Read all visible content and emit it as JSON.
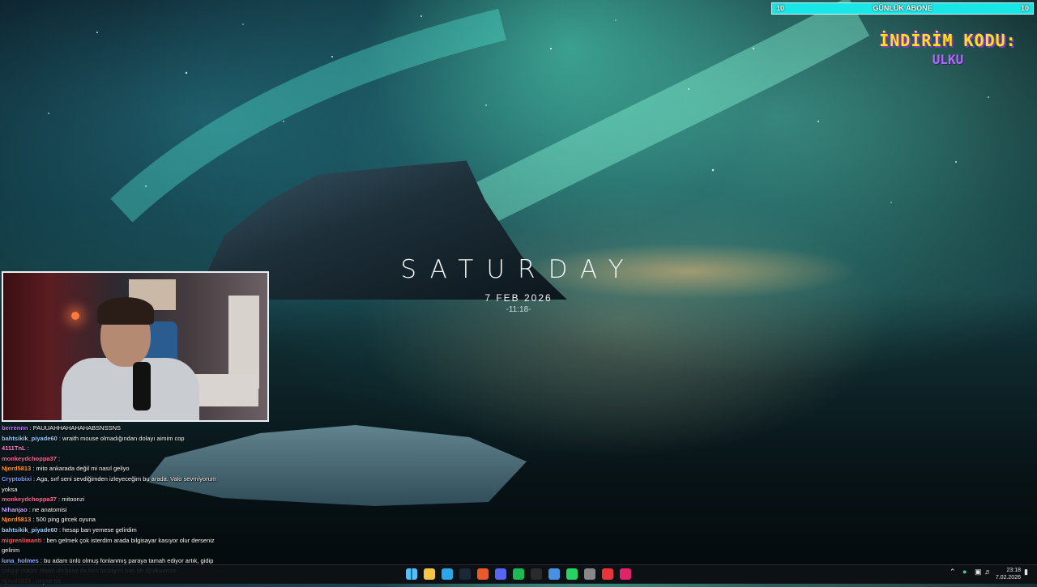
{
  "goal_bar": {
    "left_value": "10",
    "title": "GÜNLÜK ABONE",
    "right_value": "10",
    "progress": 1.0,
    "fill_color": "#19e6e6"
  },
  "promo": {
    "title": "İNDİRİM KODU:",
    "code": "ULKU"
  },
  "clock_widget": {
    "day": "SATURDAY",
    "date": "7 FEB 2026",
    "time": "-11:18-"
  },
  "chat": {
    "messages": [
      {
        "user": "berrennn",
        "text": "PAUUAHHAHAHAHABSNSSNS",
        "color": "#c07bff"
      },
      {
        "user": "bahtsikik_piyade60",
        "text": "wraith mouse olmadığından dolayı aimim cop",
        "color": "#9ad0ff"
      },
      {
        "user": "4111TnL",
        "text": "",
        "color": "#ff8ad8"
      },
      {
        "user": "monkeydchoppa37",
        "text": "",
        "color": "#ff6b9a"
      },
      {
        "user": "Njord5813",
        "text": "mito ankarada değil mi nasıl geliyo",
        "color": "#ff9a3c"
      },
      {
        "user": "Cryptobixi",
        "text": "Aga, sırf seni sevdiğimden izleyeceğim bu arada. Valo sevmiyorum yoksa",
        "color": "#7aa0ff"
      },
      {
        "user": "monkeydchoppa37",
        "text": "mitoonzi",
        "color": "#ff6b9a"
      },
      {
        "user": "Nihanjao",
        "text": "ne anatomisi",
        "color": "#c7a8ff"
      },
      {
        "user": "Njord5813",
        "text": "500 ping gircek oyuna",
        "color": "#ff9a3c"
      },
      {
        "user": "bahtsikik_piyade60",
        "text": "hesap ban yemese gelirdim",
        "color": "#9ad0ff"
      },
      {
        "user": "migrenlimanti",
        "text": "ben gelmek çok isterdim arada bilgisayar kasıyor olur derseniz gelirim",
        "color": "#ff5b5b"
      },
      {
        "user": "luna_holmes",
        "text": "bu adam ünlü olmuş fonlanmış paraya tamah ediyor artık, gidip çalışıp doktor oliyim da biraz da ben fonlayım bari bb @ulkuemre",
        "color": "#8fb4ff"
      },
      {
        "user": "Njord5813",
        "text": "neyse bb",
        "color": "#ff9a3c"
      }
    ]
  },
  "taskbar": {
    "icons": [
      "windows-start-icon",
      "file-explorer-icon",
      "edge-browser-icon",
      "steam-icon",
      "browser-icon",
      "discord-icon",
      "spotify-icon",
      "terminal-icon",
      "app-icon",
      "whatsapp-icon",
      "settings-icon",
      "media-icon",
      "store-icon"
    ],
    "clock_time": "23:18",
    "clock_date": "7.02.2026"
  }
}
